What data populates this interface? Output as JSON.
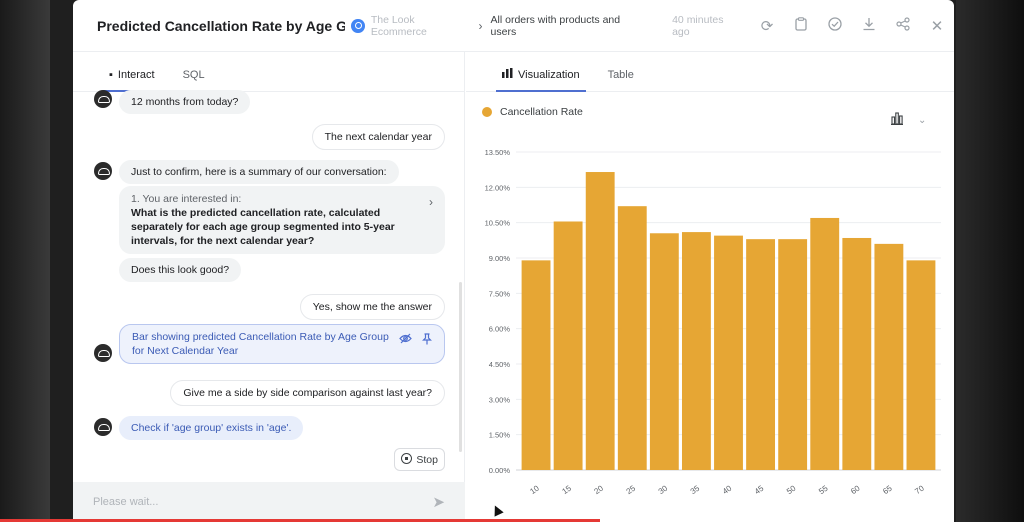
{
  "header": {
    "title": "Predicted Cancellation Rate by Age G",
    "source": "The Look Ecommerce",
    "view": "All orders with products and users",
    "updated": "40 minutes ago"
  },
  "toolbar_icons": [
    "refresh-icon",
    "clipboard-icon",
    "check-circle-icon",
    "download-icon",
    "share-icon",
    "close-icon"
  ],
  "left_tabs": [
    {
      "label": "Interact",
      "active": true
    },
    {
      "label": "SQL",
      "active": false
    }
  ],
  "right_tabs": [
    {
      "label": "Visualization",
      "active": true
    },
    {
      "label": "Table",
      "active": false
    }
  ],
  "chat": {
    "m1": "12 months from today?",
    "m2": "The next calendar year",
    "m3": "Just to confirm, here is a summary of our conversation:",
    "summary_sub": "1. You are interested in:",
    "summary_q": "What is the predicted cancellation rate, calculated separately for each age group segmented into 5-year intervals, for the next calendar year?",
    "m4": "Does this look good?",
    "m5": "Yes, show me the answer",
    "result": "Bar showing predicted Cancellation Rate by Age Group for Next Calendar Year",
    "m6": "Give me a side by side comparison against last year?",
    "working": "Check if 'age group' exists in 'age'.",
    "stop_label": "Stop"
  },
  "input": {
    "placeholder": "Please wait..."
  },
  "colors": {
    "bar": "#e6a634",
    "accent": "#4f6fd0",
    "progress": "#e53935"
  },
  "chart_data": {
    "type": "bar",
    "legend": "Cancellation Rate",
    "categories": [
      "10",
      "15",
      "20",
      "25",
      "30",
      "35",
      "40",
      "45",
      "50",
      "55",
      "60",
      "65",
      "70"
    ],
    "values": [
      8.9,
      10.55,
      12.65,
      11.2,
      10.05,
      10.1,
      9.95,
      9.8,
      9.8,
      10.7,
      9.85,
      9.6,
      8.9
    ],
    "y_ticks": [
      "0.00%",
      "1.50%",
      "3.00%",
      "4.50%",
      "6.00%",
      "7.50%",
      "9.00%",
      "10.50%",
      "12.00%",
      "13.50%"
    ],
    "ylim": [
      0,
      13.5
    ],
    "ylabel_unit": "%",
    "grid": true,
    "legend_position": "top-left"
  }
}
